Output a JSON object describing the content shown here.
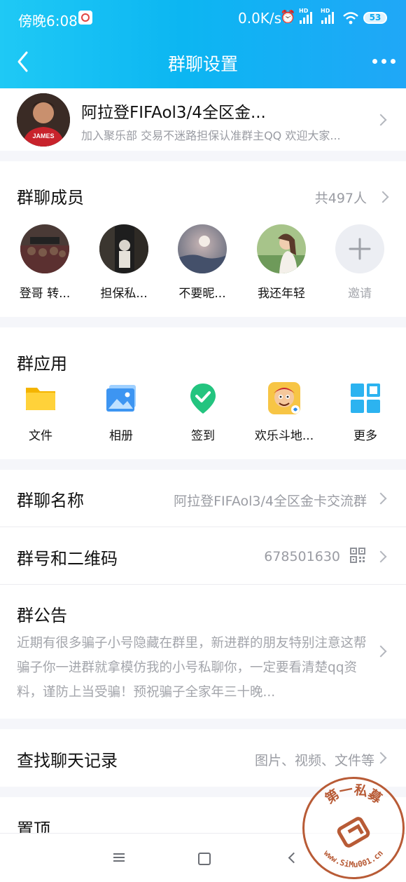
{
  "status_bar": {
    "time": "傍晚6:08",
    "speed": "0.0K/s",
    "hd_label": "HD",
    "battery": "53"
  },
  "nav": {
    "title": "群聊设置"
  },
  "group": {
    "name": "阿拉登FIFAol3/4全区金...",
    "description": "加入聚乐部 交易不迷路担保认准群主QQ 欢迎大家..."
  },
  "members": {
    "title": "群聊成员",
    "count": "共497人",
    "list": [
      {
        "name": "登哥 转..."
      },
      {
        "name": "担保私..."
      },
      {
        "name": "不要昵..."
      },
      {
        "name": "我还年轻"
      }
    ],
    "invite_label": "邀请"
  },
  "apps": {
    "title": "群应用",
    "list": [
      {
        "name": "文件",
        "icon": "folder-icon",
        "color": "#f7c51a"
      },
      {
        "name": "相册",
        "icon": "album-icon",
        "color": "#3d95f2"
      },
      {
        "name": "签到",
        "icon": "checkin-icon",
        "color": "#23c47f"
      },
      {
        "name": "欢乐斗地...",
        "icon": "game-icon",
        "color": "#f4a92d"
      },
      {
        "name": "更多",
        "icon": "grid-icon",
        "color": "#2cb3f0"
      }
    ]
  },
  "settings": {
    "group_name_label": "群聊名称",
    "group_name_value": "阿拉登FIFAol3/4全区金卡交流群",
    "group_number_label": "群号和二维码",
    "group_number_value": "678501630",
    "notice_label": "群公告",
    "notice_text": "近期有很多骗子小号隐藏在群里，新进群的朋友特别注意这帮骗子你一进群就拿模仿我的小号私聊你，一定要看清楚qq资料，谨防上当受骗！预祝骗子全家年三十晚...",
    "search_label": "查找聊天记录",
    "search_value": "图片、视频、文件等",
    "pin_label": "置顶"
  },
  "watermark": {
    "text": "第一私募",
    "url": "www.SiMu001.cn"
  },
  "colors": {
    "header_start": "#1fc9f5",
    "header_end": "#20a7f7",
    "watermark": "#b85b36"
  }
}
